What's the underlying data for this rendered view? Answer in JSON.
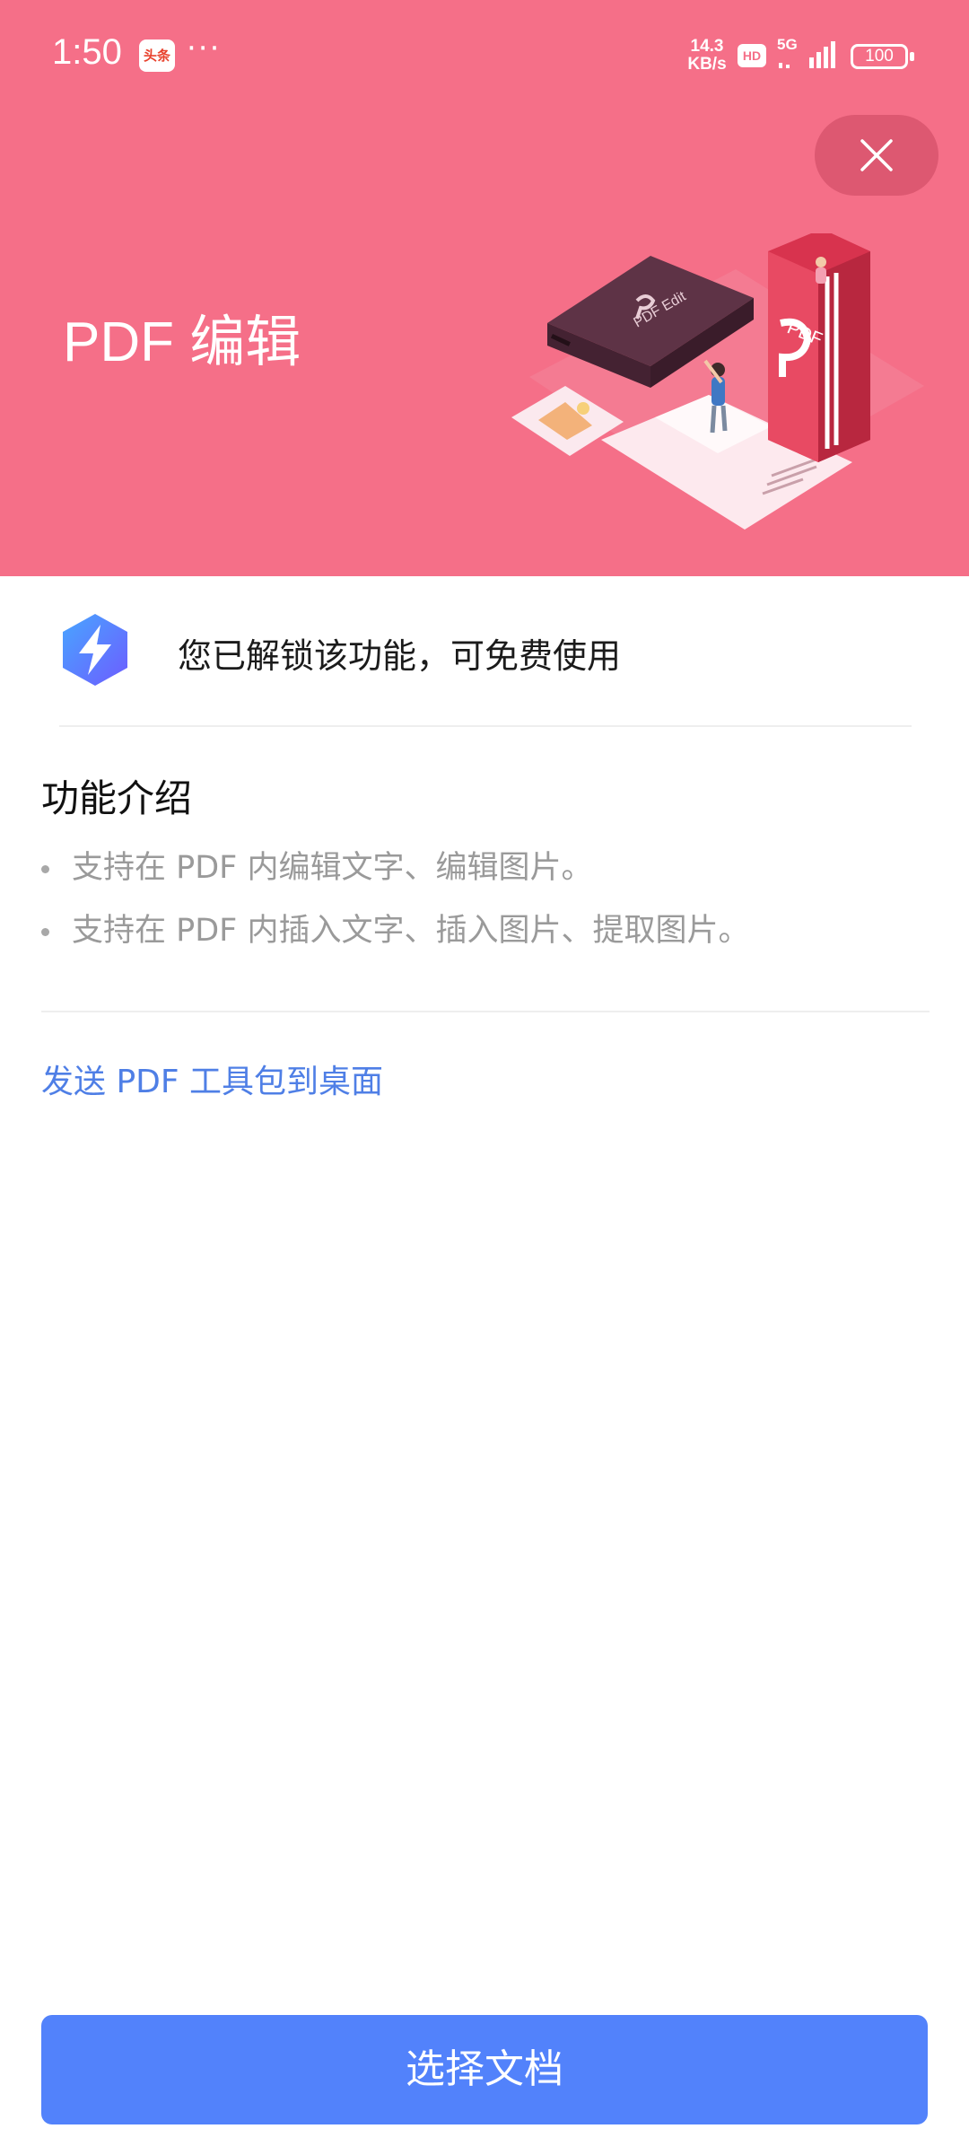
{
  "status_bar": {
    "time": "1:50",
    "app_badge": "头条",
    "more": "···",
    "net_speed_value": "14.3",
    "net_speed_unit": "KB/s",
    "hd": "HD",
    "network": "5G",
    "battery": "100"
  },
  "header": {
    "title": "PDF 编辑",
    "close_icon": "close-icon",
    "illustration_book_label": "PDF",
    "illustration_device_label": "PDF Edit"
  },
  "unlock": {
    "icon": "lightning-icon",
    "text": "您已解锁该功能，可免费使用"
  },
  "intro": {
    "title": "功能介绍",
    "items": [
      "支持在 PDF 内编辑文字、编辑图片。",
      "支持在 PDF 内插入文字、插入图片、提取图片。"
    ]
  },
  "link": {
    "send_to_desktop": "发送 PDF 工具包到桌面"
  },
  "footer": {
    "button_label": "选择文档"
  },
  "colors": {
    "hero_bg": "#f56f88",
    "primary": "#5282fb",
    "link": "#4f7fe6"
  }
}
